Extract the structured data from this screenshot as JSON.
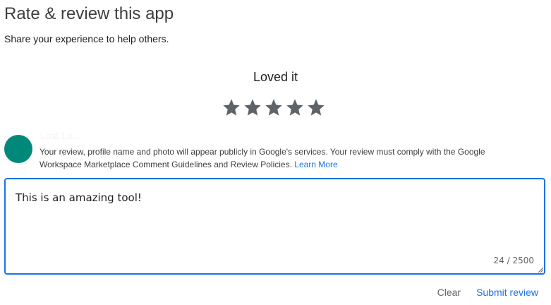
{
  "header": {
    "title": "Rate & review this app",
    "subtitle": "Share your experience to help others."
  },
  "rating": {
    "label": "Loved it",
    "value": 5,
    "max": 5,
    "star_color": "#5f6368"
  },
  "user": {
    "name": "Lost Lo...",
    "avatar_color": "#00897b"
  },
  "notice": {
    "text": "Your review, profile name and photo will appear publicly in Google's services. Your review must comply with the Google Workspace Marketplace Comment Guidelines and Review Policies.",
    "link_label": "Learn More"
  },
  "review": {
    "value": "This is an amazing tool!",
    "counter": "24 / 2500"
  },
  "actions": {
    "clear_label": "Clear",
    "submit_label": "Submit review"
  },
  "colors": {
    "accent": "#1a73e8",
    "text_secondary": "#5f6368"
  }
}
